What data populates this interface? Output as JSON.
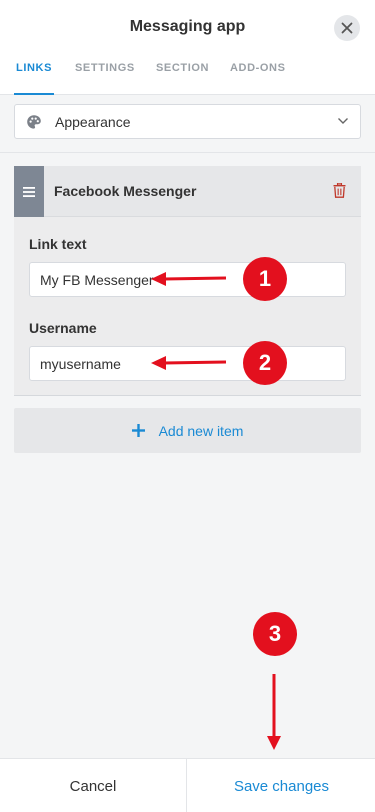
{
  "header": {
    "title": "Messaging app",
    "close_icon": "close-icon"
  },
  "tabs": [
    {
      "label": "LINKS",
      "active": true
    },
    {
      "label": "SETTINGS",
      "active": false
    },
    {
      "label": "SECTION",
      "active": false
    },
    {
      "label": "ADD-ONS",
      "active": false
    }
  ],
  "appearance": {
    "icon": "palette-icon",
    "label": "Appearance",
    "chevron": "chevron-down-icon"
  },
  "item": {
    "title": "Facebook Messenger",
    "drag_icon": "hamburger-icon",
    "delete_icon": "trash-icon",
    "fields": [
      {
        "label": "Link text",
        "value": "My FB Messenger"
      },
      {
        "label": "Username",
        "value": "myusername"
      }
    ]
  },
  "add_item": {
    "icon": "plus-icon",
    "label": "Add new item"
  },
  "footer": {
    "cancel_label": "Cancel",
    "save_label": "Save changes"
  },
  "annotations": {
    "badges": [
      "1",
      "2",
      "3"
    ],
    "color": "#e3101e"
  },
  "colors": {
    "accent": "#1a8ad4",
    "danger": "#c0392b",
    "handle": "#7e8794"
  }
}
